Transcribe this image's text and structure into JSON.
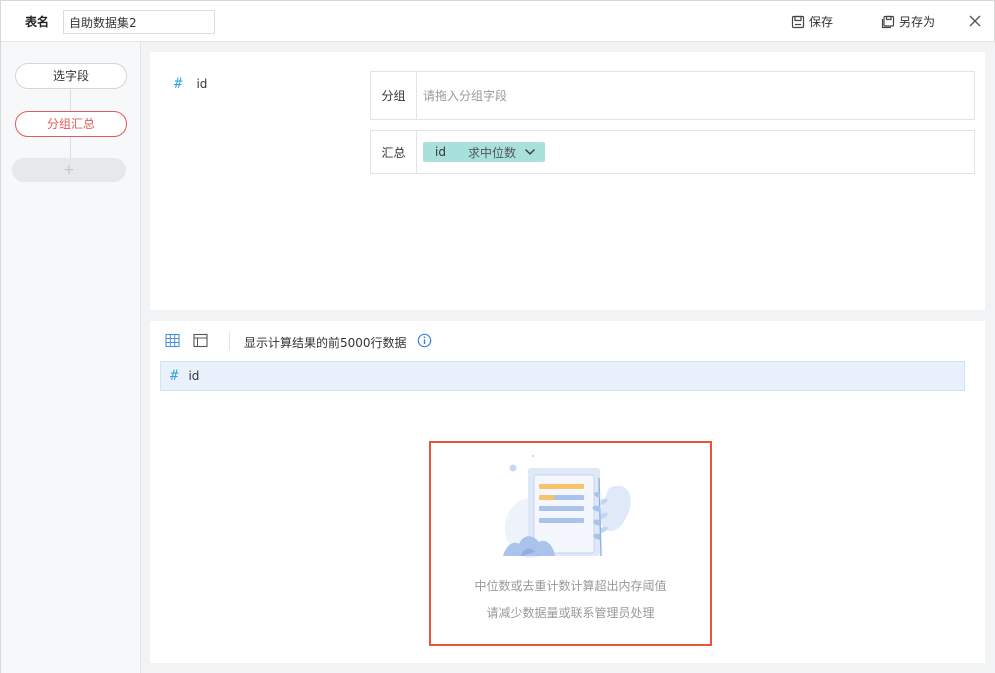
{
  "header": {
    "table_name_label": "表名",
    "table_name_value": "自助数据集2",
    "save_label": "保存",
    "save_as_label": "另存为"
  },
  "sidebar": {
    "steps": [
      {
        "label": "选字段",
        "active": false
      },
      {
        "label": "分组汇总",
        "active": true
      }
    ],
    "add_label": "+"
  },
  "config": {
    "fields": [
      {
        "type": "#",
        "name": "id"
      }
    ],
    "group_label": "分组",
    "group_placeholder": "请拖入分组字段",
    "summary_label": "汇总",
    "summary_chip": {
      "field": "id",
      "aggregation": "求中位数"
    }
  },
  "result": {
    "info_text": "显示计算结果的前5000行数据",
    "columns": [
      {
        "type": "#",
        "name": "id"
      }
    ],
    "empty_message_line1": "中位数或去重计数计算超出内存阈值",
    "empty_message_line2": "请减少数据量或联系管理员处理"
  },
  "colors": {
    "accent": "#3aa6d8",
    "active_step": "#e35b5b",
    "chip_bg": "#a8e0dc",
    "highlight_border": "#e8543a"
  }
}
